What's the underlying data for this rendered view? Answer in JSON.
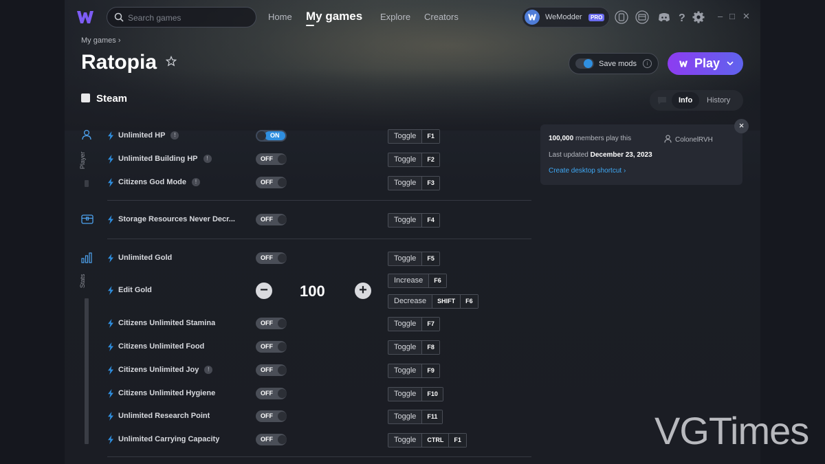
{
  "app": {
    "name": "WeModder",
    "plan": "PRO"
  },
  "search": {
    "placeholder": "Search games"
  },
  "nav": {
    "home": "Home",
    "my_games": "My games",
    "explore": "Explore",
    "creators": "Creators"
  },
  "window": {
    "minimize": "–",
    "maximize": "□",
    "close": "✕"
  },
  "breadcrumb": {
    "parent": "My games",
    "separator": "›"
  },
  "game": {
    "title": "Ratopia",
    "platform": "Steam"
  },
  "actions": {
    "save_mods": "Save mods",
    "play": "Play"
  },
  "tabs": {
    "info": "Info",
    "history": "History"
  },
  "info_panel": {
    "members_count": "100,000",
    "members_text": "members play this",
    "author": "ColonelRVH",
    "last_updated_label": "Last updated",
    "last_updated_date": "December 23, 2023",
    "shortcut_link": "Create desktop shortcut ›",
    "close": "×"
  },
  "categories": {
    "player": "Player",
    "stats": "Stats"
  },
  "cheats": [
    {
      "name": "Unlimited HP",
      "warn": true,
      "state": "ON",
      "action": "Toggle",
      "keys": [
        "F1"
      ]
    },
    {
      "name": "Unlimited Building HP",
      "warn": true,
      "state": "OFF",
      "action": "Toggle",
      "keys": [
        "F2"
      ]
    },
    {
      "name": "Citizens God Mode",
      "warn": true,
      "state": "OFF",
      "action": "Toggle",
      "keys": [
        "F3"
      ]
    },
    {
      "name": "Storage Resources Never Decr...",
      "warn": false,
      "state": "OFF",
      "action": "Toggle",
      "keys": [
        "F4"
      ]
    },
    {
      "name": "Unlimited Gold",
      "warn": false,
      "state": "OFF",
      "action": "Toggle",
      "keys": [
        "F5"
      ]
    },
    {
      "name": "Citizens Unlimited Stamina",
      "warn": false,
      "state": "OFF",
      "action": "Toggle",
      "keys": [
        "F7"
      ]
    },
    {
      "name": "Citizens Unlimited Food",
      "warn": false,
      "state": "OFF",
      "action": "Toggle",
      "keys": [
        "F8"
      ]
    },
    {
      "name": "Citizens Unlimited Joy",
      "warn": true,
      "state": "OFF",
      "action": "Toggle",
      "keys": [
        "F9"
      ]
    },
    {
      "name": "Citizens Unlimited Hygiene",
      "warn": false,
      "state": "OFF",
      "action": "Toggle",
      "keys": [
        "F10"
      ]
    },
    {
      "name": "Unlimited Research Point",
      "warn": false,
      "state": "OFF",
      "action": "Toggle",
      "keys": [
        "F11"
      ]
    },
    {
      "name": "Unlimited Carrying Capacity",
      "warn": false,
      "state": "OFF",
      "action": "Toggle",
      "keys": [
        "CTRL",
        "F1"
      ]
    }
  ],
  "edit_gold": {
    "name": "Edit Gold",
    "value": "100",
    "minus": "−",
    "plus": "+",
    "increase": {
      "label": "Increase",
      "keys": [
        "F6"
      ]
    },
    "decrease": {
      "label": "Decrease",
      "keys": [
        "SHIFT",
        "F6"
      ]
    }
  },
  "watermark": "VGTimes",
  "colors": {
    "accent": "#2f8fe0",
    "play_start": "#8d3cf0",
    "play_end": "#5f63ee",
    "link": "#3fa9f5",
    "bolt": "#2f8fe0"
  }
}
